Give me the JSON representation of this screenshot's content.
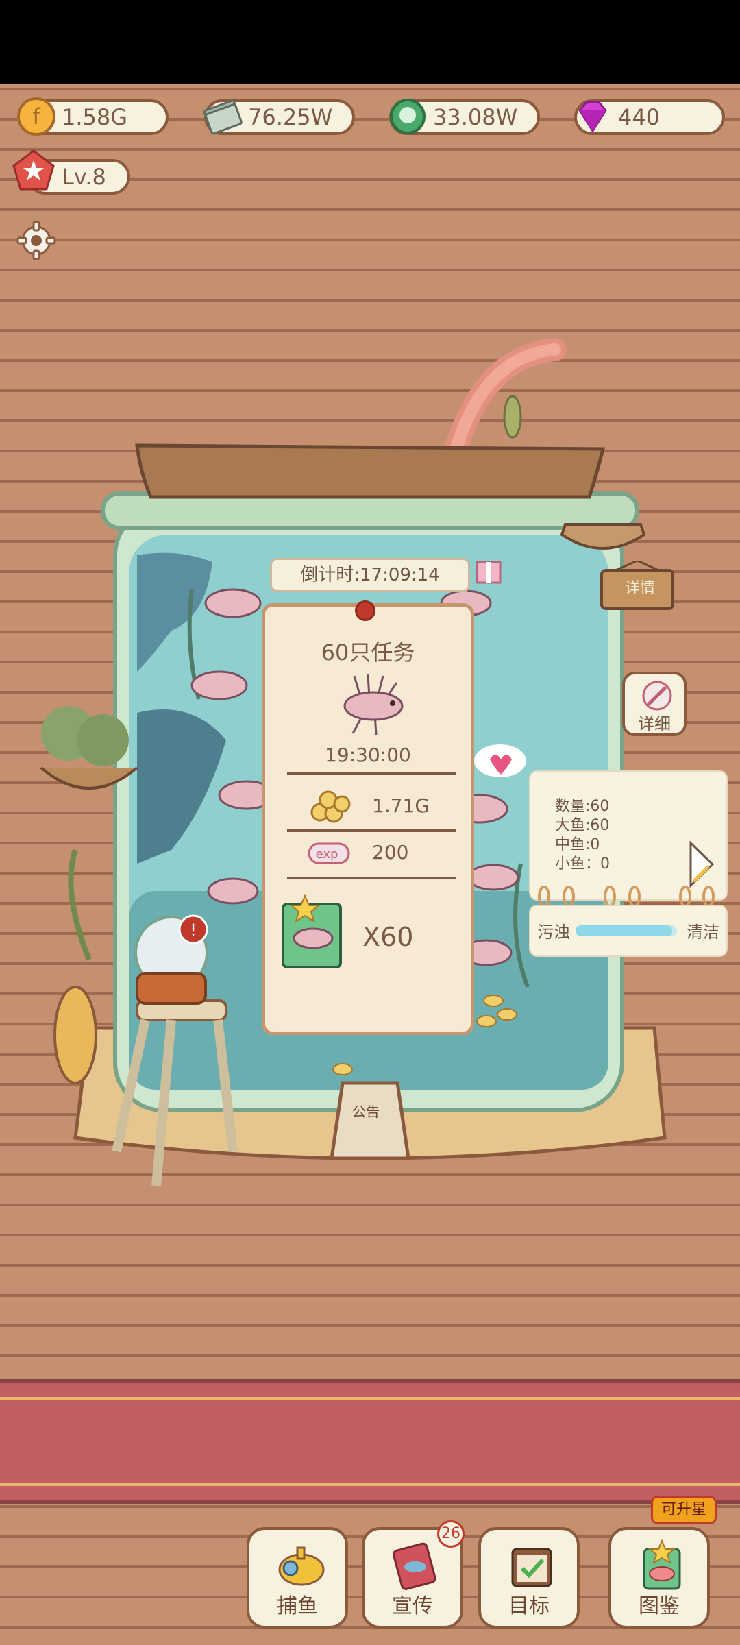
{
  "currencies": {
    "gold": "1.58G",
    "cash": "76.25W",
    "pearl": "33.08W",
    "gem": "440"
  },
  "level": "Lv.8",
  "task": {
    "timer": "倒计时:17:09:14",
    "title": "60只任务",
    "time": "19:30:00",
    "reward_gold": "1.71G",
    "exp_label": "exp",
    "reward_exp": "200",
    "reward_count": "X60"
  },
  "sign_label": "详情",
  "detail_button": "详细",
  "info": {
    "count": "数量:60",
    "big_fish": "大鱼:60",
    "mid_fish": "中鱼:0",
    "small_fish": "小鱼：0"
  },
  "cleanliness": {
    "left_label": "污浊",
    "right_label": "清洁",
    "level": 0.95
  },
  "notice_board": "公告",
  "nav": {
    "fishing": "捕鱼",
    "promo": "宣传",
    "promo_badge": "26",
    "goals": "目标",
    "collection": "图鉴",
    "upgrade_tag": "可升星"
  },
  "colors": {
    "background": "#c4906f",
    "banner": "#c15f63",
    "water": "#8fd0cf",
    "accent_upgrade": "#f0a21e"
  }
}
